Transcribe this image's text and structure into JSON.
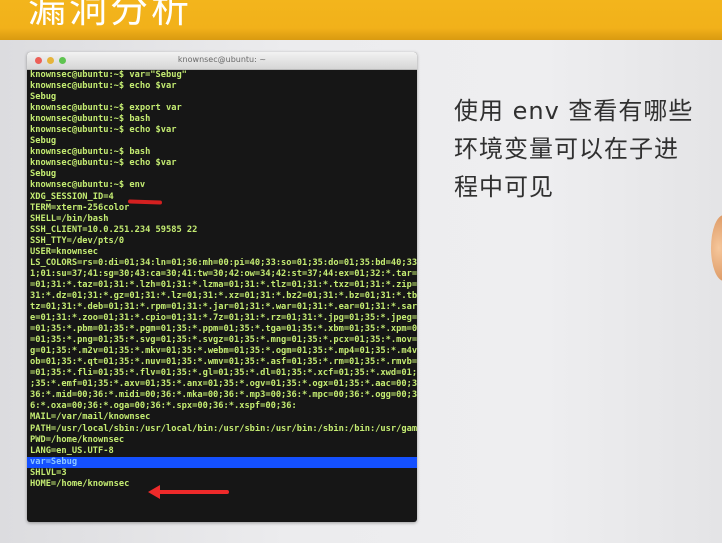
{
  "slide": {
    "title": "漏洞分析",
    "description_lines": [
      "使用 env 查看有哪些",
      "环境变量可以在子进",
      "程中可见"
    ]
  },
  "terminal": {
    "window_title": "knownsec@ubuntu: ~",
    "lines": [
      "knownsec@ubuntu:~$ var=\"Sebug\"",
      "knownsec@ubuntu:~$ echo $var",
      "Sebug",
      "knownsec@ubuntu:~$ export var",
      "knownsec@ubuntu:~$ bash",
      "knownsec@ubuntu:~$ echo $var",
      "Sebug",
      "knownsec@ubuntu:~$ bash",
      "knownsec@ubuntu:~$ echo $var",
      "Sebug",
      "knownsec@ubuntu:~$ env",
      "XDG_SESSION_ID=4",
      "TERM=xterm-256color",
      "SHELL=/bin/bash",
      "SSH_CLIENT=10.0.251.234 59585 22",
      "SSH_TTY=/dev/pts/0",
      "USER=knownsec",
      "LS_COLORS=rs=0:di=01;34:ln=01;36:mh=00:pi=40;33:so=01;35:do=01;35:bd=40;33",
      "1;01:su=37;41:sg=30;43:ca=30;41:tw=30;42:ow=34;42:st=37;44:ex=01;32:*.tar=",
      "=01;31:*.taz=01;31:*.lzh=01;31:*.lzma=01;31:*.tlz=01;31:*.txz=01;31:*.zip=",
      "31:*.dz=01;31:*.gz=01;31:*.lz=01;31:*.xz=01;31:*.bz2=01;31:*.bz=01;31:*.tb",
      "tz=01;31:*.deb=01;31:*.rpm=01;31:*.jar=01;31:*.war=01;31:*.ear=01;31:*.sar",
      "e=01;31:*.zoo=01;31:*.cpio=01;31:*.7z=01;31:*.rz=01;31:*.jpg=01;35:*.jpeg=",
      "=01;35:*.pbm=01;35:*.pgm=01;35:*.ppm=01;35:*.tga=01;35:*.xbm=01;35:*.xpm=0",
      "=01;35:*.png=01;35:*.svg=01;35:*.svgz=01;35:*.mng=01;35:*.pcx=01;35:*.mov=",
      "g=01;35:*.m2v=01;35:*.mkv=01;35:*.webm=01;35:*.ogm=01;35:*.mp4=01;35:*.m4v",
      "ob=01;35:*.qt=01;35:*.nuv=01;35:*.wmv=01;35:*.asf=01;35:*.rm=01;35:*.rmvb=",
      "=01;35:*.fli=01;35:*.flv=01;35:*.gl=01;35:*.dl=01;35:*.xcf=01;35:*.xwd=01;",
      ";35:*.emf=01;35:*.axv=01;35:*.anx=01;35:*.ogv=01;35:*.ogx=01;35:*.aac=00;3",
      "36:*.mid=00;36:*.midi=00;36:*.mka=00;36:*.mp3=00;36:*.mpc=00;36:*.ogg=00;3",
      "6:*.oxa=00;36:*.oga=00;36:*.spx=00;36:*.xspf=00;36:",
      "MAIL=/var/mail/knownsec",
      "PATH=/usr/local/sbin:/usr/local/bin:/usr/sbin:/usr/bin:/sbin:/bin:/usr/gam",
      "PWD=/home/knownsec",
      "LANG=en_US.UTF-8",
      "var=Sebug",
      "SHLVL=3",
      "HOME=/home/knownsec"
    ],
    "highlighted_line": 35,
    "highlight_color": "#1450ff",
    "text_color": "#c4ec72"
  },
  "annotations": {
    "env_underline_color": "#d42020",
    "arrow_color": "#ee2a2a"
  },
  "colors": {
    "title_bar": "#f2b11a",
    "terminal_bg": "#161616"
  }
}
